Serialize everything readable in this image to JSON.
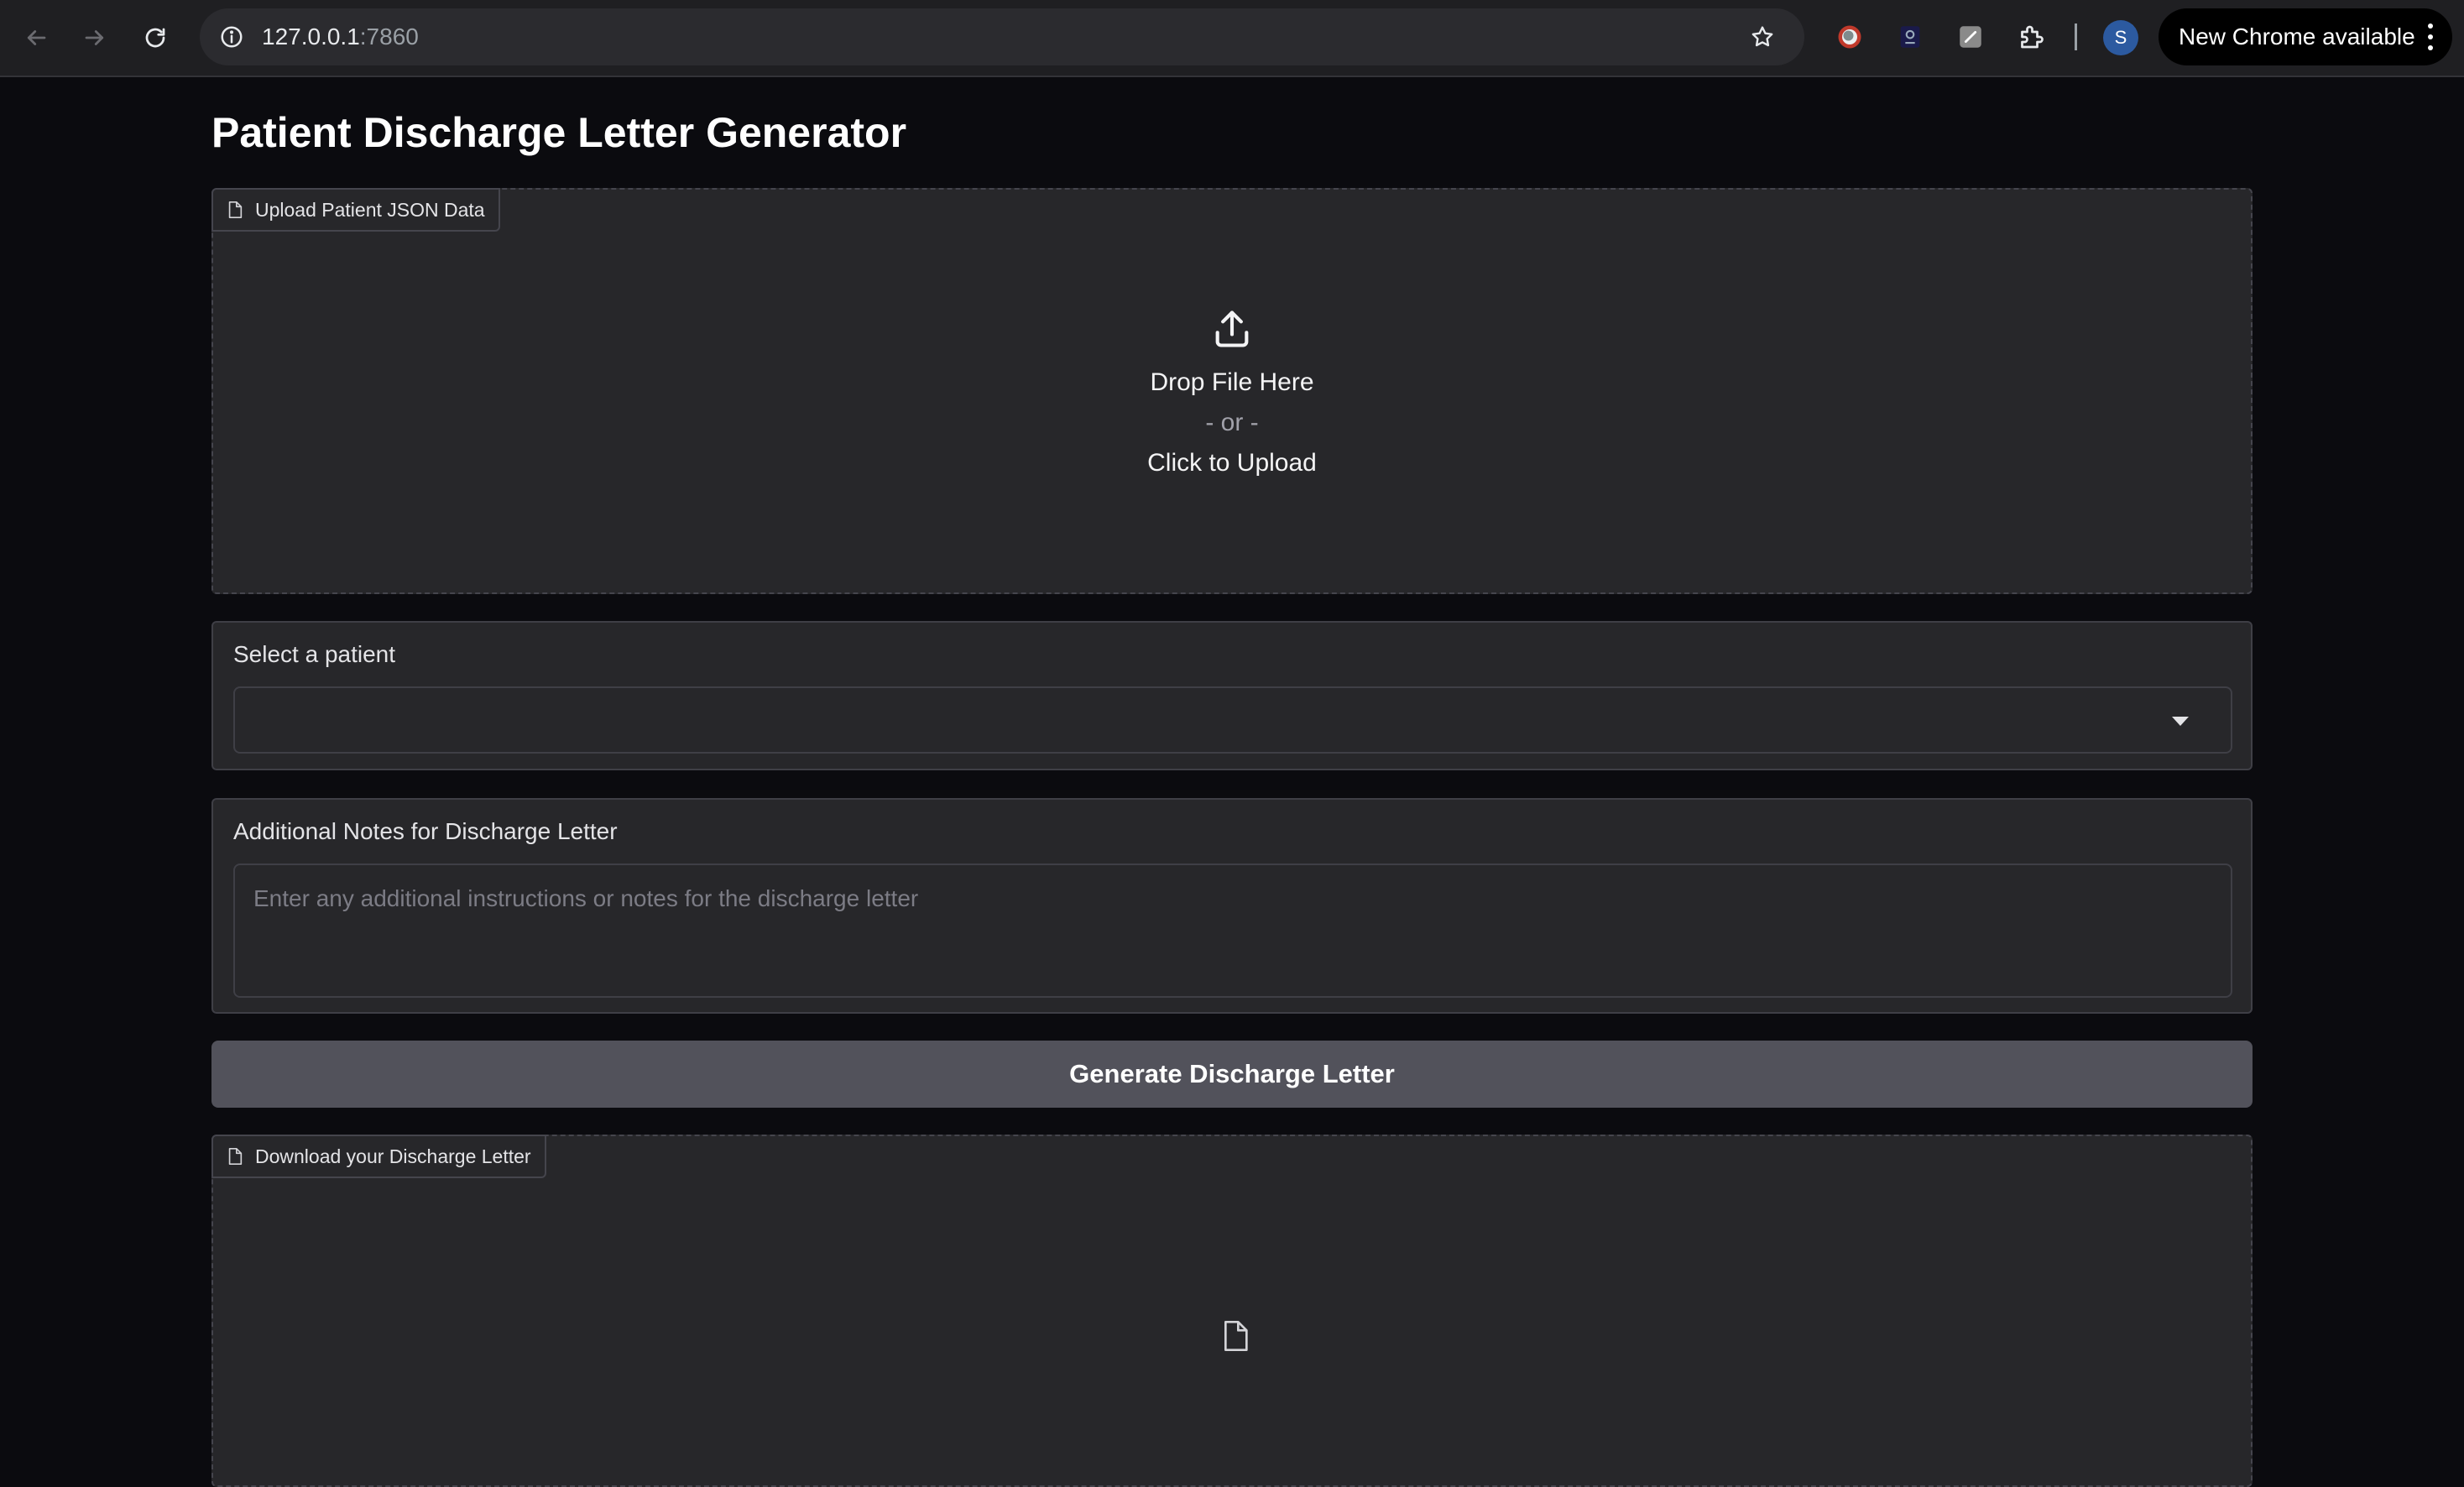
{
  "browser": {
    "url_host": "127.0.0.1",
    "url_port": ":7860",
    "profile_initial": "S",
    "update_label": "New Chrome available"
  },
  "app": {
    "title": "Patient Discharge Letter Generator",
    "upload": {
      "label": "Upload Patient JSON Data",
      "drop_text": "Drop File Here",
      "or_text": "- or -",
      "click_text": "Click to Upload"
    },
    "patient_select": {
      "label": "Select a patient",
      "value": ""
    },
    "notes": {
      "label": "Additional Notes for Discharge Letter",
      "placeholder": "Enter any additional instructions or notes for the discharge letter",
      "value": ""
    },
    "generate_button": "Generate Discharge Letter",
    "download": {
      "label": "Download your Discharge Letter"
    }
  }
}
